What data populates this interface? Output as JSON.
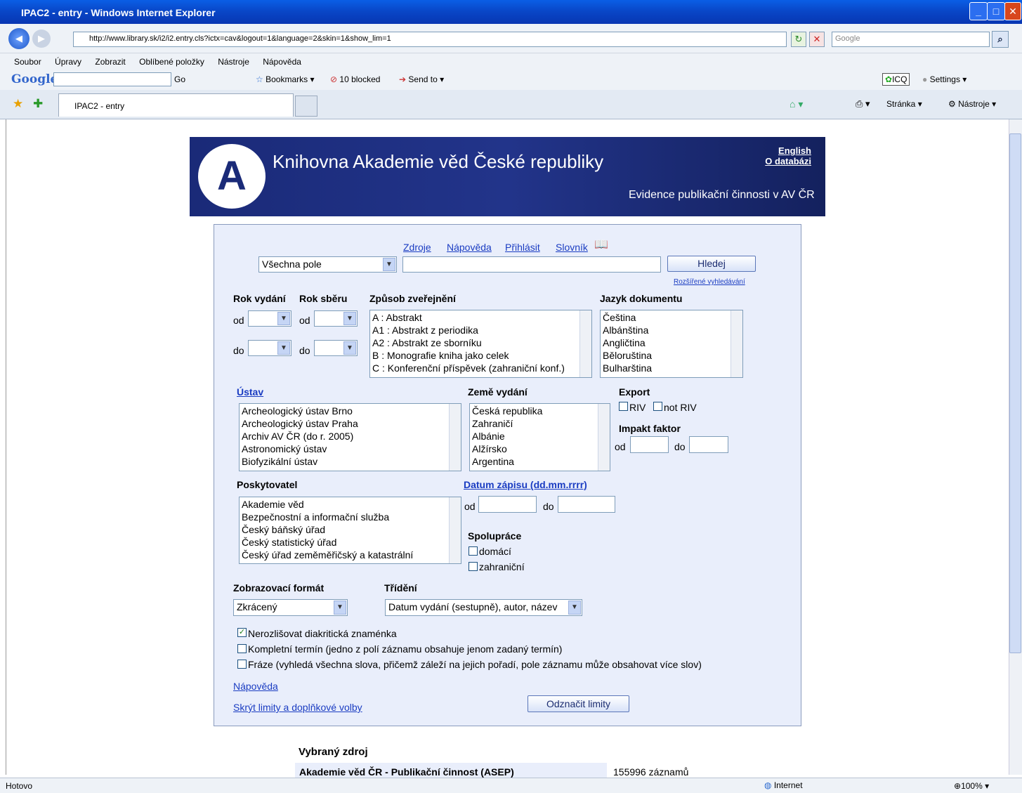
{
  "window": {
    "title": "IPAC2 - entry - Windows Internet Explorer"
  },
  "browser": {
    "url": "http://www.library.sk/i2/i2.entry.cls?ictx=cav&logout=1&language=2&skin=1&show_lim=1",
    "search_placeholder": "Google",
    "menu": [
      "Soubor",
      "Úpravy",
      "Zobrazit",
      "Oblíbené položky",
      "Nástroje",
      "Nápověda"
    ],
    "toolbar": {
      "go": "Go",
      "bookmarks": "Bookmarks",
      "blocked": "10 blocked",
      "send_to": "Send to",
      "icq": "ICQ",
      "settings": "Settings"
    },
    "tab_label": "IPAC2 - entry",
    "cmd": {
      "page": "Stránka",
      "tools": "Nástroje"
    },
    "status": {
      "left": "Hotovo",
      "zone": "Internet",
      "zoom": "100%"
    }
  },
  "banner": {
    "title": "Knihovna Akademie věd České republiky",
    "subtitle": "Evidence publikační činnosti v AV ČR",
    "english": "English",
    "about": "O databázi",
    "logo_letter": "A"
  },
  "search": {
    "links": [
      "Zdroje",
      "Nápověda",
      "Přihlásit",
      "Slovník"
    ],
    "field_select": "Všechna pole",
    "query": "",
    "button": "Hledej",
    "advanced": "Rozšířené vyhledávání"
  },
  "limits": {
    "rok_vydani": "Rok vydání",
    "rok_sberu": "Rok sběru",
    "od": "od",
    "do": "do",
    "zpusob": "Způsob zveřejnění",
    "zpusob_items": [
      "A : Abstrakt",
      "A1 : Abstrakt z periodika",
      "A2 : Abstrakt ze sborníku",
      "B : Monografie kniha jako celek",
      "C : Konferenční příspěvek (zahraniční konf.)"
    ],
    "jazyk": "Jazyk dokumentu",
    "jazyk_items": [
      "Čeština",
      "Albánština",
      "Angličtina",
      "Běloruština",
      "Bulharština"
    ],
    "ustav": "Ústav",
    "ustav_items": [
      "Archeologický ústav Brno",
      "Archeologický ústav Praha",
      "Archiv AV ČR (do r. 2005)",
      "Astronomický ústav",
      "Biofyzikální ústav"
    ],
    "zeme": "Země vydání",
    "zeme_items": [
      "Česká republika",
      "Zahraničí",
      "Albánie",
      "Alžírsko",
      "Argentina"
    ],
    "export": "Export",
    "riv": "RIV",
    "not_riv": "not RIV",
    "impakt": "Impakt faktor",
    "poskytovatel": "Poskytovatel",
    "poskytovatel_items": [
      "Akademie věd",
      "Bezpečnostní a informační služba",
      "Český báňský úřad",
      "Český statistický úřad",
      "Český úřad zeměměřičský a katastrální"
    ],
    "datum": "Datum zápisu (dd.mm.rrrr)",
    "spoluprace": "Spolupráce",
    "domaci": "domácí",
    "zahranicni": "zahraniční",
    "format": "Zobrazovací formát",
    "format_value": "Zkrácený",
    "trideni": "Třídění",
    "trideni_value": "Datum vydání (sestupně), autor, název",
    "opt1": "Nerozlišovat diakritická znaménka",
    "opt2": "Kompletní termín (jedno z polí záznamu obsahuje jenom zadaný termín)",
    "opt3": "Fráze (vyhledá všechna slova, přičemž záleží na jejich pořadí, pole záznamu může obsahovat více slov)",
    "help": "Nápověda",
    "hide": "Skrýt limity a doplňkové volby",
    "clear": "Odznačit limity"
  },
  "source": {
    "heading": "Vybraný zdroj",
    "name": "Akademie věd ČR - Publikační činnost (ASEP)",
    "count": "155996 záznamů"
  }
}
